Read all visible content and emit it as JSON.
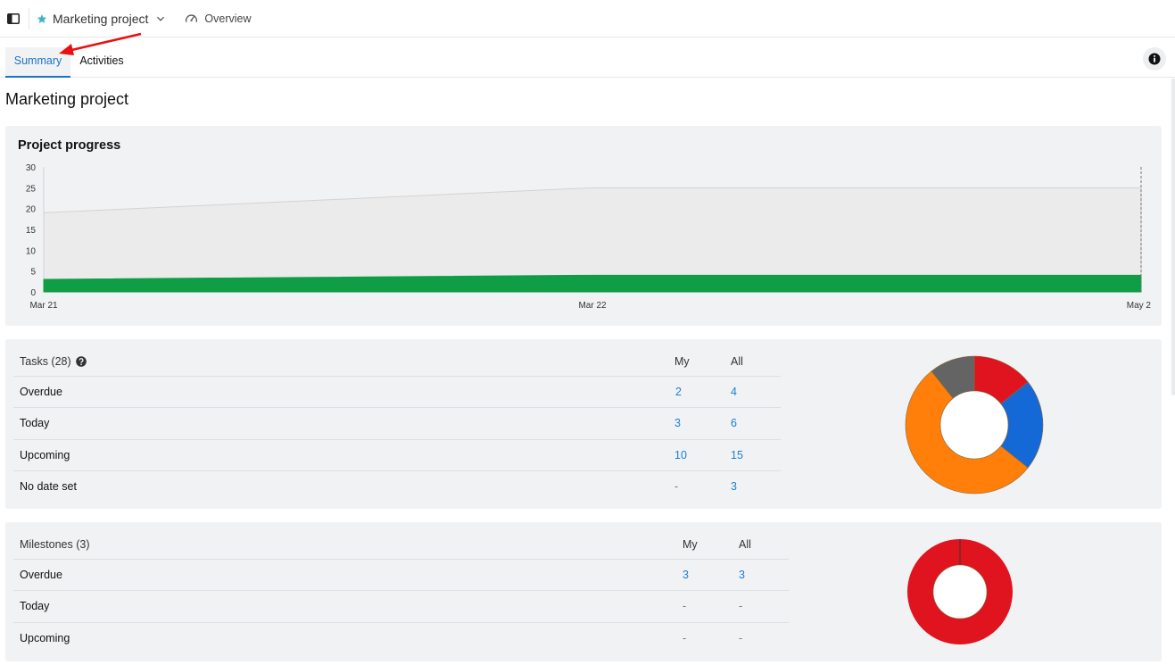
{
  "header": {
    "project_name": "Marketing project",
    "overview_label": "Overview"
  },
  "tabs": [
    {
      "label": "Summary",
      "active": true
    },
    {
      "label": "Activities",
      "active": false
    }
  ],
  "page_title": "Marketing project",
  "colors": {
    "accent": "#1a73c8",
    "link": "#1a7fd4",
    "progress_green": "#0f9d45",
    "overdue_red": "#e0141e",
    "today_blue": "#1469d6",
    "upcoming_orange": "#ff7f0a",
    "no_date_gray": "#646464"
  },
  "progress_panel": {
    "title": "Project progress"
  },
  "chart_data": [
    {
      "type": "area",
      "title": "Project progress",
      "x": [
        "Mar 21",
        "Mar 22",
        "May 2"
      ],
      "x_tick_labels": [
        "Mar 21",
        "Mar 22",
        "May 2"
      ],
      "y_ticks": [
        0,
        5,
        10,
        15,
        20,
        25,
        30
      ],
      "ylim": [
        0,
        30
      ],
      "series": [
        {
          "values": [
            19,
            25,
            25
          ],
          "color": "#ebebeb"
        },
        {
          "values": [
            3,
            4,
            4
          ],
          "color": "#0f9d45"
        }
      ]
    },
    {
      "type": "pie",
      "labels": [
        "Overdue",
        "Today",
        "Upcoming",
        "No date set"
      ],
      "values": [
        4,
        6,
        15,
        3
      ],
      "colors": [
        "#e0141e",
        "#1469d6",
        "#ff7f0a",
        "#646464"
      ]
    },
    {
      "type": "pie",
      "labels": [
        "Overdue",
        "Today",
        "Upcoming"
      ],
      "values": [
        3,
        0,
        0
      ],
      "colors": [
        "#e0141e",
        "#1469d6",
        "#ff7f0a"
      ]
    }
  ],
  "tasks": {
    "header": "Tasks (28)",
    "col_my": "My",
    "col_all": "All",
    "rows": [
      {
        "label": "Overdue",
        "my": "2",
        "all": "4"
      },
      {
        "label": "Today",
        "my": "3",
        "all": "6"
      },
      {
        "label": "Upcoming",
        "my": "10",
        "all": "15"
      },
      {
        "label": "No date set",
        "my": "-",
        "all": "3"
      }
    ]
  },
  "milestones": {
    "header": "Milestones (3)",
    "col_my": "My",
    "col_all": "All",
    "rows": [
      {
        "label": "Overdue",
        "my": "3",
        "all": "3"
      },
      {
        "label": "Today",
        "my": "-",
        "all": "-"
      },
      {
        "label": "Upcoming",
        "my": "-",
        "all": "-"
      }
    ]
  }
}
